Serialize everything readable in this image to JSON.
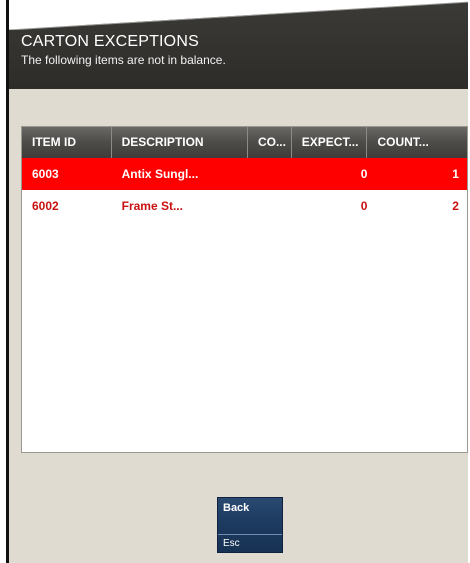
{
  "header": {
    "title": "CARTON EXCEPTIONS",
    "subtitle": "The following items are not in balance."
  },
  "table": {
    "columns": [
      "ITEM ID",
      "DESCRIPTION",
      "CO...",
      "EXPECT...",
      "COUNT..."
    ],
    "rows": [
      {
        "item_id": "6003",
        "description": "Antix Sungl...",
        "co": "",
        "expected": "0",
        "counted": "1",
        "selected": true
      },
      {
        "item_id": "6002",
        "description": "Frame St...",
        "co": "",
        "expected": "0",
        "counted": "2",
        "selected": false
      }
    ]
  },
  "buttons": {
    "back_label": "Back",
    "back_shortcut": "Esc"
  },
  "colors": {
    "header_bg": "#343330",
    "window_bg": "#e0dbd0",
    "selected_row": "#ff0000",
    "row_text": "#c91111",
    "button_bg": "#1d3a60"
  }
}
